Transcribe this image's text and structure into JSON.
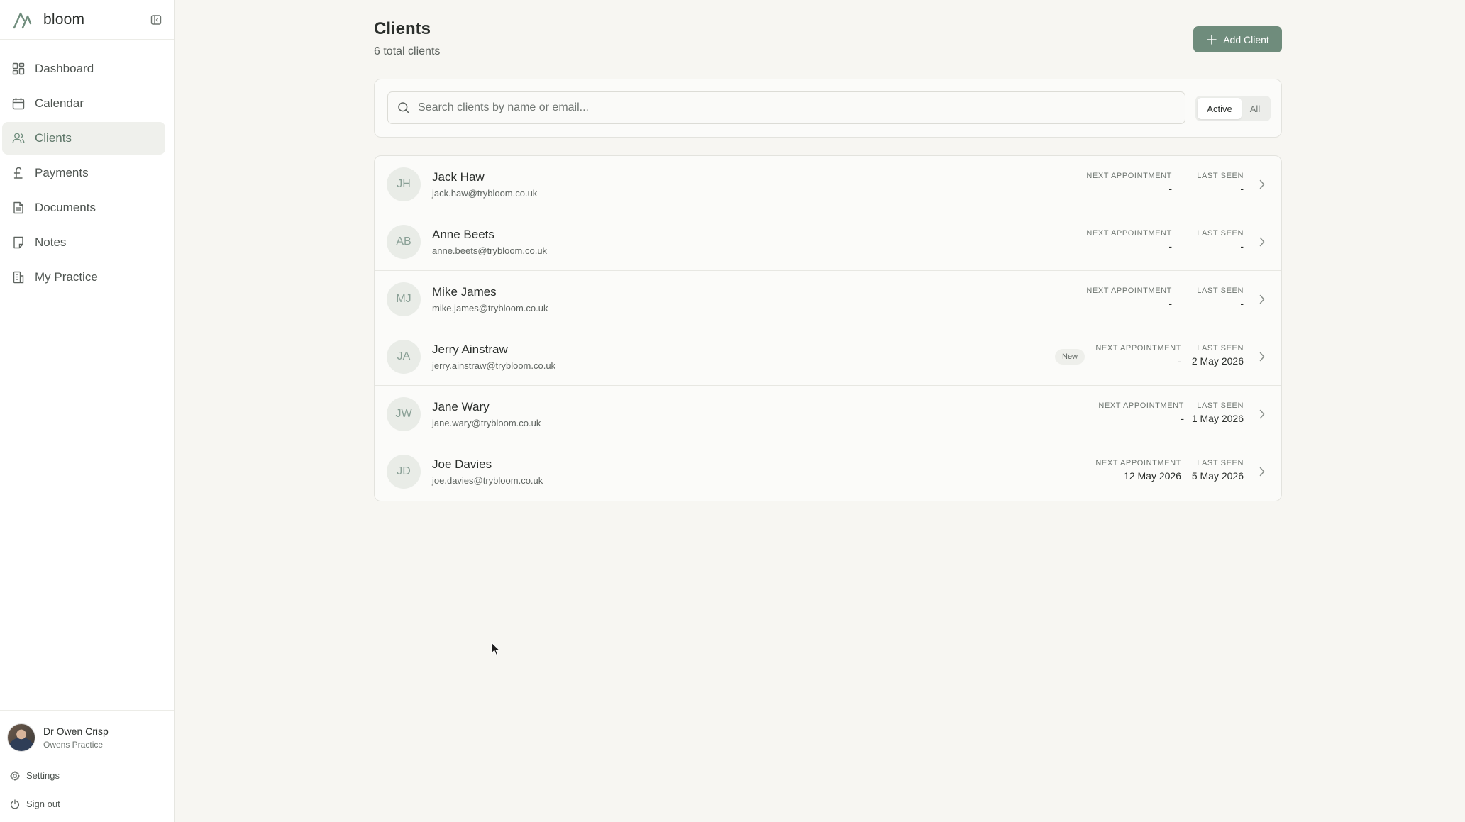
{
  "app": {
    "brand": "bloom",
    "colors": {
      "accent": "#6f8c7c",
      "active_nav_bg": "#eff0ec",
      "background": "#f7f6f2"
    }
  },
  "sidebar": {
    "items": [
      {
        "label": "Dashboard",
        "icon": "dashboard-icon"
      },
      {
        "label": "Calendar",
        "icon": "calendar-icon"
      },
      {
        "label": "Clients",
        "icon": "users-icon",
        "active": true
      },
      {
        "label": "Payments",
        "icon": "pound-icon"
      },
      {
        "label": "Documents",
        "icon": "document-icon"
      },
      {
        "label": "Notes",
        "icon": "note-icon"
      },
      {
        "label": "My Practice",
        "icon": "building-icon"
      }
    ],
    "user": {
      "name": "Dr Owen Crisp",
      "practice": "Owens Practice"
    },
    "settings_label": "Settings",
    "signout_label": "Sign out"
  },
  "main": {
    "title": "Clients",
    "subtitle": "6 total clients",
    "add_button_label": "Add Client",
    "search": {
      "placeholder": "Search clients by name or email...",
      "value": ""
    },
    "filter": {
      "options": [
        "Active",
        "All"
      ],
      "selected": "Active"
    },
    "columns": {
      "next": "NEXT APPOINTMENT",
      "last": "LAST SEEN"
    },
    "clients": [
      {
        "initials": "JH",
        "name": "Jack Haw",
        "email": "jack.haw@trybloom.co.uk",
        "badge": "",
        "next": "-",
        "last": "-"
      },
      {
        "initials": "AB",
        "name": "Anne Beets",
        "email": "anne.beets@trybloom.co.uk",
        "badge": "",
        "next": "-",
        "last": "-"
      },
      {
        "initials": "MJ",
        "name": "Mike James",
        "email": "mike.james@trybloom.co.uk",
        "badge": "",
        "next": "-",
        "last": "-"
      },
      {
        "initials": "JA",
        "name": "Jerry Ainstraw",
        "email": "jerry.ainstraw@trybloom.co.uk",
        "badge": "New",
        "next": "-",
        "last": "2 May 2026"
      },
      {
        "initials": "JW",
        "name": "Jane Wary",
        "email": "jane.wary@trybloom.co.uk",
        "badge": "",
        "next": "-",
        "last": "1 May 2026"
      },
      {
        "initials": "JD",
        "name": "Joe Davies",
        "email": "joe.davies@trybloom.co.uk",
        "badge": "",
        "next": "12 May 2026",
        "last": "5 May 2026"
      }
    ]
  }
}
